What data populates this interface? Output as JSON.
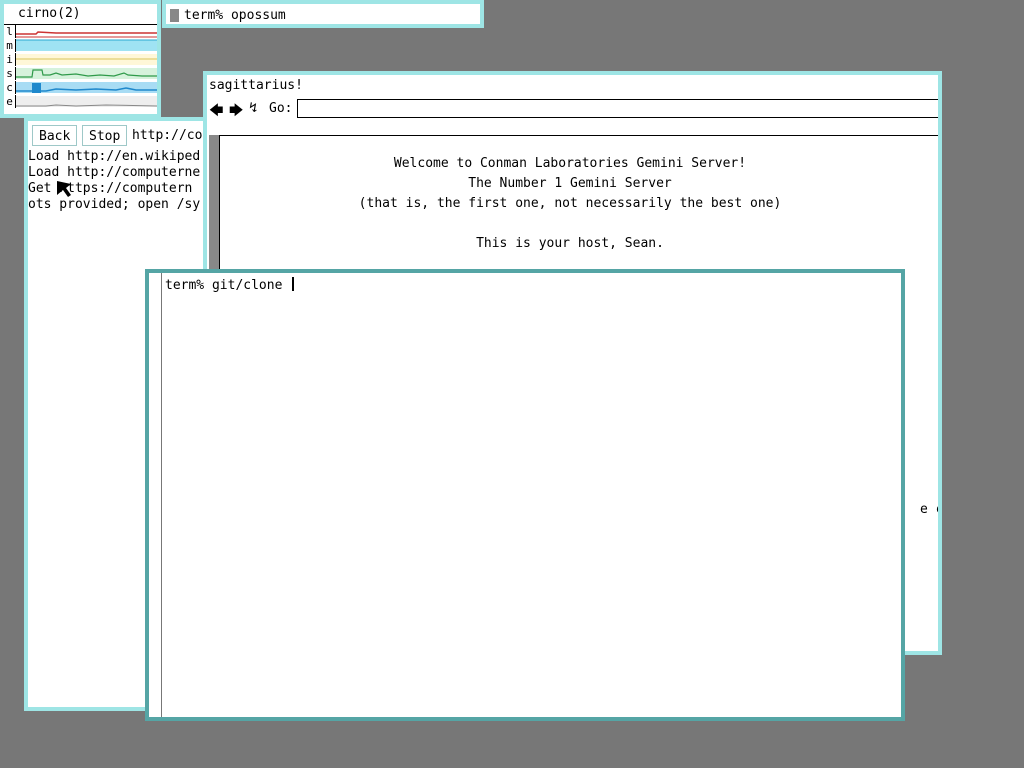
{
  "stats": {
    "title": "cirno(2)",
    "rows": [
      {
        "label": "l",
        "color": "#cc3333"
      },
      {
        "label": "m",
        "color": "#2aa8d0"
      },
      {
        "label": "i",
        "color": "#d8c45a"
      },
      {
        "label": "s",
        "color": "#2f9a4a"
      },
      {
        "label": "c",
        "color": "#1f88cc"
      },
      {
        "label": "e",
        "color": "#888888"
      }
    ]
  },
  "small_term": {
    "text": "term% opossum"
  },
  "browser": {
    "back_label": "Back",
    "stop_label": "Stop",
    "url": "http://co",
    "log": [
      "Load http://en.wikiped",
      "Load http://computerne",
      "Get  https://computern",
      "ots provided; open /sy"
    ]
  },
  "gemini": {
    "title": "sagittarius!",
    "go_label": "Go:",
    "go_value": "",
    "lines": [
      "Welcome to Conman Laboratories Gemini Server!",
      "The Number 1 Gemini Server",
      "(that is, the first one, not necessarily the best one)",
      "",
      "This is your host, Sean."
    ],
    "edge_fragment": "e cod"
  },
  "terminal": {
    "prompt": "term% git/clone "
  },
  "colors": {
    "desktop": "#777777",
    "border_inactive": "#9ee5e5",
    "border_active": "#55a5a5"
  }
}
